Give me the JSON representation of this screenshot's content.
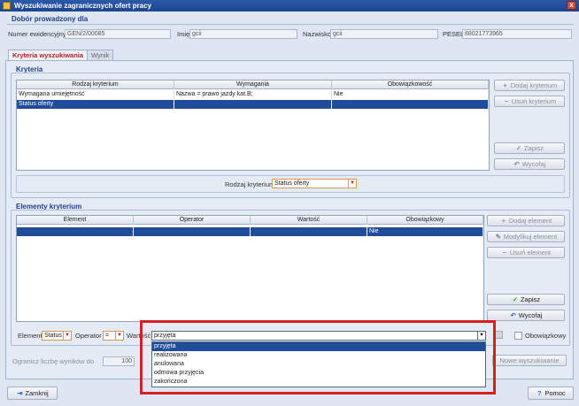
{
  "window": {
    "title": "Wyszukiwanie zagranicznych ofert pracy",
    "close": "x"
  },
  "header": {
    "section_title": "Dobór prowadzony dla",
    "fields": [
      {
        "label": "Numer ewidencyjny",
        "value": "GEN/2/00085"
      },
      {
        "label": "Imię",
        "value": "gcii"
      },
      {
        "label": "Nazwisko",
        "value": "gcii"
      },
      {
        "label": "PESEL",
        "value": "88021773965"
      }
    ]
  },
  "tabs": [
    {
      "label": "Kryteria wyszukiwania",
      "active": true
    },
    {
      "label": "Wynik",
      "active": false
    }
  ],
  "kryteria": {
    "section_title": "Kryteria",
    "columns": [
      "Rodzaj kryterium",
      "Wymagania",
      "Obowiązkowość"
    ],
    "rows": [
      [
        "Wymagana umiejętność",
        "Nazwa = prawo jazdy kat.B;",
        "Nie"
      ],
      [
        "Status oferty",
        "",
        ""
      ]
    ],
    "buttons": {
      "add": "Dodaj kryterium",
      "remove": "Usuń kryterium",
      "save": "Zapisz",
      "cancel": "Wycofaj"
    },
    "type_label": "Rodzaj kryterium",
    "type_value": "Status oferty"
  },
  "elementy": {
    "section_title": "Elementy kryterium",
    "columns": [
      "Element",
      "Operator",
      "Wartość",
      "Obowiązkowy"
    ],
    "rows": [
      [
        "",
        "",
        "",
        "Nie"
      ]
    ],
    "buttons": {
      "add": "Dodaj element",
      "modify": "Modyfikuj element",
      "remove": "Usuń element",
      "save": "Zapisz",
      "cancel": "Wycofaj"
    },
    "element_label": "Element",
    "element_value": "Status",
    "operator_label": "Operator",
    "operator_value": "=",
    "value_label": "Wartość",
    "value_value": "przyjęta",
    "options": [
      "przyjęta",
      "realizowana",
      "anulowana",
      "odmowa przyjęcia",
      "zakończona"
    ],
    "required_label": "Obowiązkowy"
  },
  "footer": {
    "limit_label": "Ogranicz liczbę wyników do",
    "limit_value": "100",
    "new_search": "Nowe wyszukiwanie",
    "close": "Zamknij",
    "help": "Pomoc"
  },
  "colors": {
    "accent": "#1f4d9a",
    "highlight": "#d42020"
  }
}
